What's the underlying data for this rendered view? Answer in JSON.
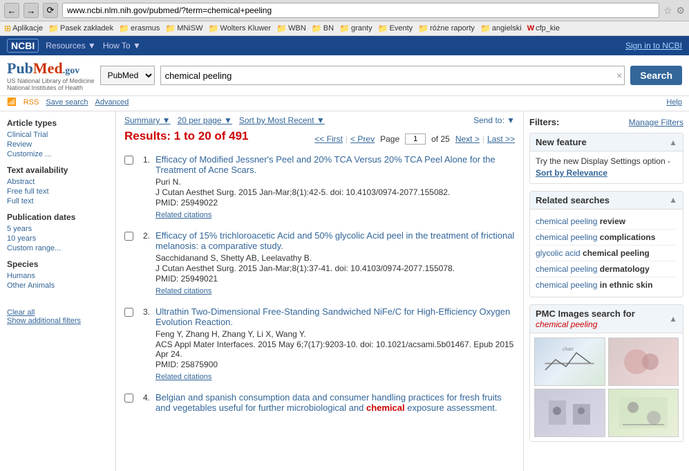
{
  "browser": {
    "url": "www.ncbi.nlm.nih.gov/pubmed/?term=chemical+peeling",
    "bookmarks": [
      {
        "label": "Aplikacje"
      },
      {
        "label": "Pasek zakładek"
      },
      {
        "label": "erasmus"
      },
      {
        "label": "MNiSW"
      },
      {
        "label": "Wolters Kluwer"
      },
      {
        "label": "WBN"
      },
      {
        "label": "BN"
      },
      {
        "label": "granty"
      },
      {
        "label": "Eventy"
      },
      {
        "label": "różne raporty"
      },
      {
        "label": "angielski"
      },
      {
        "label": "cfp_kie"
      }
    ]
  },
  "ncbi_header": {
    "badge": "NCBI",
    "resources": "Resources",
    "howto": "How To",
    "sign_in": "Sign in to NCBI"
  },
  "search_bar": {
    "logo_pub": "Pub",
    "logo_med": "Med",
    "logo_gov": ".gov",
    "subtitle_line1": "US National Library of Medicine",
    "subtitle_line2": "National Institutes of Health",
    "database_options": [
      "PubMed"
    ],
    "database_selected": "PubMed",
    "query": "chemical peeling",
    "search_label": "Search",
    "clear_label": "×"
  },
  "sub_search_bar": {
    "rss_label": "RSS",
    "save_search": "Save search",
    "advanced": "Advanced",
    "help": "Help"
  },
  "left_sidebar": {
    "article_types_title": "Article types",
    "article_types": [
      {
        "label": "Clinical Trial"
      },
      {
        "label": "Review"
      },
      {
        "label": "Customize ..."
      }
    ],
    "text_availability_title": "Text availability",
    "text_availability": [
      {
        "label": "Abstract"
      },
      {
        "label": "Free full text"
      },
      {
        "label": "Full text"
      }
    ],
    "publication_dates_title": "Publication dates",
    "publication_dates": [
      {
        "label": "5 years"
      },
      {
        "label": "10 years"
      },
      {
        "label": "Custom range..."
      }
    ],
    "species_title": "Species",
    "species": [
      {
        "label": "Humans"
      },
      {
        "label": "Other Animals"
      }
    ],
    "clear_all": "Clear all",
    "show_additional": "Show additional filters"
  },
  "toolbar": {
    "summary_label": "Summary",
    "per_page_label": "20 per page",
    "sort_label": "Sort by Most Recent",
    "send_to_label": "Send to:"
  },
  "results": {
    "count_text": "Results: 1 to 20 of 491",
    "pagination": {
      "first": "<< First",
      "prev": "< Prev",
      "page_label": "Page",
      "current_page": "1",
      "of_label": "of 25",
      "next": "Next >",
      "last": "Last >>"
    },
    "items": [
      {
        "num": "1.",
        "title": "Efficacy of Modified Jessner's Peel and 20% TCA Versus 20% TCA Peel Alone for the Treatment of Acne Scars.",
        "authors": "Puri N.",
        "journal": "J Cutan Aesthet Surg. 2015 Jan-Mar;8(1):42-5. doi: 10.4103/0974-2077.155082.",
        "pmid": "PMID: 25949022",
        "related": "Related citations"
      },
      {
        "num": "2.",
        "title": "Efficacy of 15% trichloroacetic Acid and 50% glycolic Acid peel in the treatment of frictional melanosis: a comparative study.",
        "authors": "Sacchidanand S, Shetty AB, Leelavathy B.",
        "journal": "J Cutan Aesthet Surg. 2015 Jan-Mar;8(1):37-41. doi: 10.4103/0974-2077.155078.",
        "pmid": "PMID: 25949021",
        "related": "Related citations"
      },
      {
        "num": "3.",
        "title": "Ultrathin Two-Dimensional Free-Standing Sandwiched NiFe/C for High-Efficiency Oxygen Evolution Reaction.",
        "authors": "Feng Y, Zhang H, Zhang Y, Li X, Wang Y.",
        "journal": "ACS Appl Mater Interfaces. 2015 May 6;7(17):9203-10. doi: 10.1021/acsami.5b01467. Epub 2015 Apr 24.",
        "pmid": "PMID: 25875900",
        "related": "Related citations"
      },
      {
        "num": "4.",
        "title_parts": [
          {
            "text": "Belgian and spanish consumption data and consumer handling practices for fresh fruits and vegetables useful for further microbiological and ",
            "highlight": false
          },
          {
            "text": "chemical",
            "highlight": true
          },
          {
            "text": " exposure assessment.",
            "highlight": false
          }
        ],
        "authors": "",
        "journal": "",
        "pmid": "",
        "related": ""
      }
    ]
  },
  "right_sidebar": {
    "filters_label": "Filters:",
    "manage_filters": "Manage Filters",
    "new_feature": {
      "title": "New feature",
      "body": "Try the new Display Settings option -",
      "sort_link": "Sort by Relevance"
    },
    "related_searches": {
      "title": "Related searches",
      "items": [
        {
          "plain": "chemical peeling",
          "bold": "review"
        },
        {
          "plain": "chemical peeling",
          "bold": "complications"
        },
        {
          "plain": "glycolic acid",
          "bold": "chemical peeling"
        },
        {
          "plain": "chemical peeling",
          "bold": "dermatology"
        },
        {
          "plain": "chemical peeling",
          "bold": "in ethnic skin"
        }
      ]
    },
    "pmc_images": {
      "title": "PMC Images search for",
      "query": "chemical peeling"
    }
  }
}
